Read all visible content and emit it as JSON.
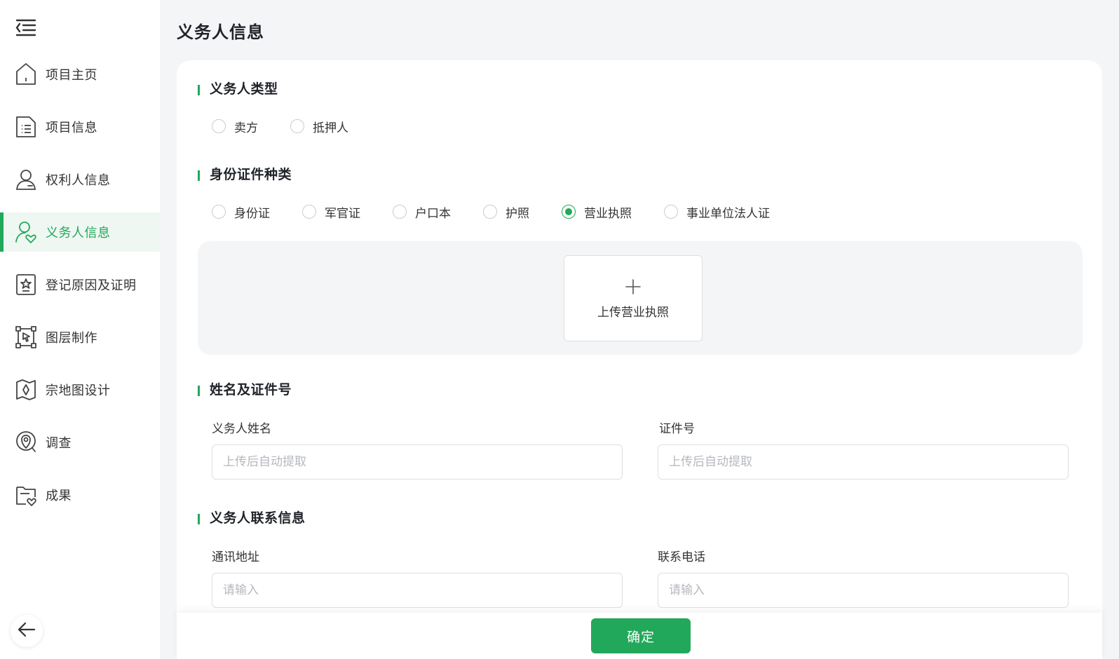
{
  "sidebar": {
    "items": [
      {
        "label": "项目主页",
        "icon": "home-icon"
      },
      {
        "label": "项目信息",
        "icon": "document-list-icon"
      },
      {
        "label": "权利人信息",
        "icon": "user-icon"
      },
      {
        "label": "义务人信息",
        "icon": "user-heart-icon",
        "active": true
      },
      {
        "label": "登记原因及证明",
        "icon": "certificate-star-icon"
      },
      {
        "label": "图层制作",
        "icon": "layer-cursor-icon"
      },
      {
        "label": "宗地图设计",
        "icon": "map-icon"
      },
      {
        "label": "调查",
        "icon": "location-search-icon"
      },
      {
        "label": "成果",
        "icon": "folder-result-icon"
      }
    ]
  },
  "page": {
    "title": "义务人信息"
  },
  "sections": {
    "obligor_type": {
      "title": "义务人类型",
      "options": [
        "卖方",
        "抵押人"
      ],
      "selected": null
    },
    "id_type": {
      "title": "身份证件种类",
      "options": [
        "身份证",
        "军官证",
        "户口本",
        "护照",
        "营业执照",
        "事业单位法人证"
      ],
      "selected": "营业执照"
    },
    "upload": {
      "label": "上传营业执照"
    },
    "name_id": {
      "title": "姓名及证件号",
      "name_label": "义务人姓名",
      "name_placeholder": "上传后自动提取",
      "id_label": "证件号",
      "id_placeholder": "上传后自动提取"
    },
    "contact": {
      "title": "义务人联系信息",
      "address_label": "通讯地址",
      "address_placeholder": "请输入",
      "phone_label": "联系电话",
      "phone_placeholder": "请输入"
    }
  },
  "footer": {
    "confirm_label": "确定"
  },
  "colors": {
    "accent": "#22a85a",
    "active_bg": "#eef7f1",
    "page_bg": "#f4f5f7"
  }
}
